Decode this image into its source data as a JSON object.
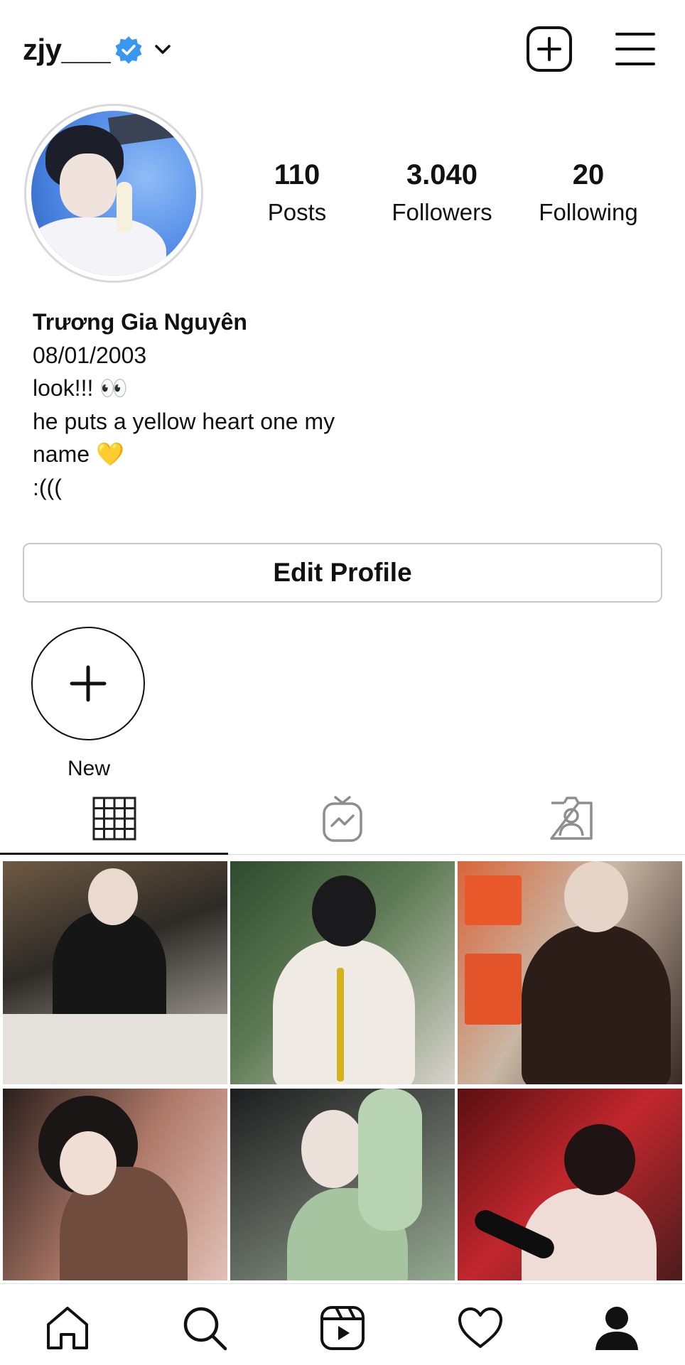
{
  "header": {
    "username": "zjy___",
    "verified_icon": "verified-badge-icon",
    "accent_color": "#3897f0",
    "new_post_icon": "add-square-icon",
    "menu_icon": "hamburger-menu-icon"
  },
  "profile": {
    "stats": [
      {
        "value": "110",
        "label": "Posts"
      },
      {
        "value": "3.040",
        "label": "Followers"
      },
      {
        "value": "20",
        "label": "Following"
      }
    ],
    "bio": {
      "name": "Trương Gia Nguyên",
      "lines": [
        "08/01/2003",
        "look!!! 👀",
        "he puts a yellow heart one my",
        "name 💛",
        ":((("
      ]
    },
    "edit_profile_label": "Edit Profile"
  },
  "highlights": {
    "new_label": "New"
  },
  "tabs": [
    {
      "icon": "grid-icon",
      "selected": true
    },
    {
      "icon": "igtv-icon",
      "selected": false
    },
    {
      "icon": "tagged-icon",
      "selected": false
    }
  ],
  "bottom_nav": [
    {
      "icon": "home-icon"
    },
    {
      "icon": "search-icon"
    },
    {
      "icon": "reels-icon"
    },
    {
      "icon": "heart-icon"
    },
    {
      "icon": "profile-icon",
      "selected": true
    }
  ]
}
